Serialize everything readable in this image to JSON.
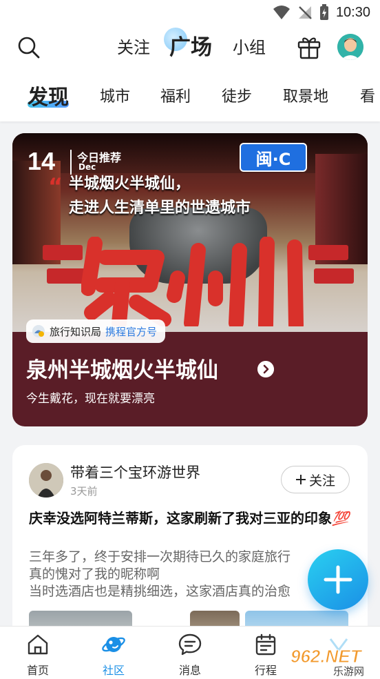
{
  "status_bar": {
    "time": "10:30"
  },
  "top_nav": {
    "tabs": [
      {
        "label": "关注"
      },
      {
        "label": "广场"
      },
      {
        "label": "小组"
      }
    ]
  },
  "category_tabs": [
    "发现",
    "城市",
    "福利",
    "徒步",
    "取景地",
    "看"
  ],
  "feature": {
    "date_day": "14",
    "date_month": "Dec",
    "recommend_label": "今日推荐",
    "headline_line1": "半城烟火半城仙，",
    "headline_line2": "走进人生清单里的世遗城市",
    "plate_text": "闽·C",
    "calligraphy": "泉州",
    "source_name": "旅行知识局",
    "source_tag": "携程官方号",
    "title": "泉州半城烟火半城仙",
    "subtitle": "今生戴花，现在就要漂亮"
  },
  "post": {
    "author": "带着三个宝环游世界",
    "time": "3天前",
    "follow_label": "关注",
    "title": "庆幸没选阿特兰蒂斯，这家刷新了我对三亚的印象",
    "title_emoji": "💯",
    "body_lines": [
      "三年多了，终于安排一次期待已久的家庭旅行",
      "真的愧对了我的昵称啊",
      "当时选酒店也是精挑细选，这家酒店真的治愈"
    ]
  },
  "bottom_nav": [
    {
      "label": "首页",
      "icon": "home-icon"
    },
    {
      "label": "社区",
      "icon": "planet-icon",
      "active": true
    },
    {
      "label": "消息",
      "icon": "message-icon"
    },
    {
      "label": "行程",
      "icon": "calendar-icon"
    }
  ],
  "watermark": {
    "brand": "962.NET",
    "site": "乐游网"
  },
  "colors": {
    "accent": "#1a8fe6",
    "feature_bg": "#5a1d27",
    "calligraphy": "#d9312b"
  }
}
